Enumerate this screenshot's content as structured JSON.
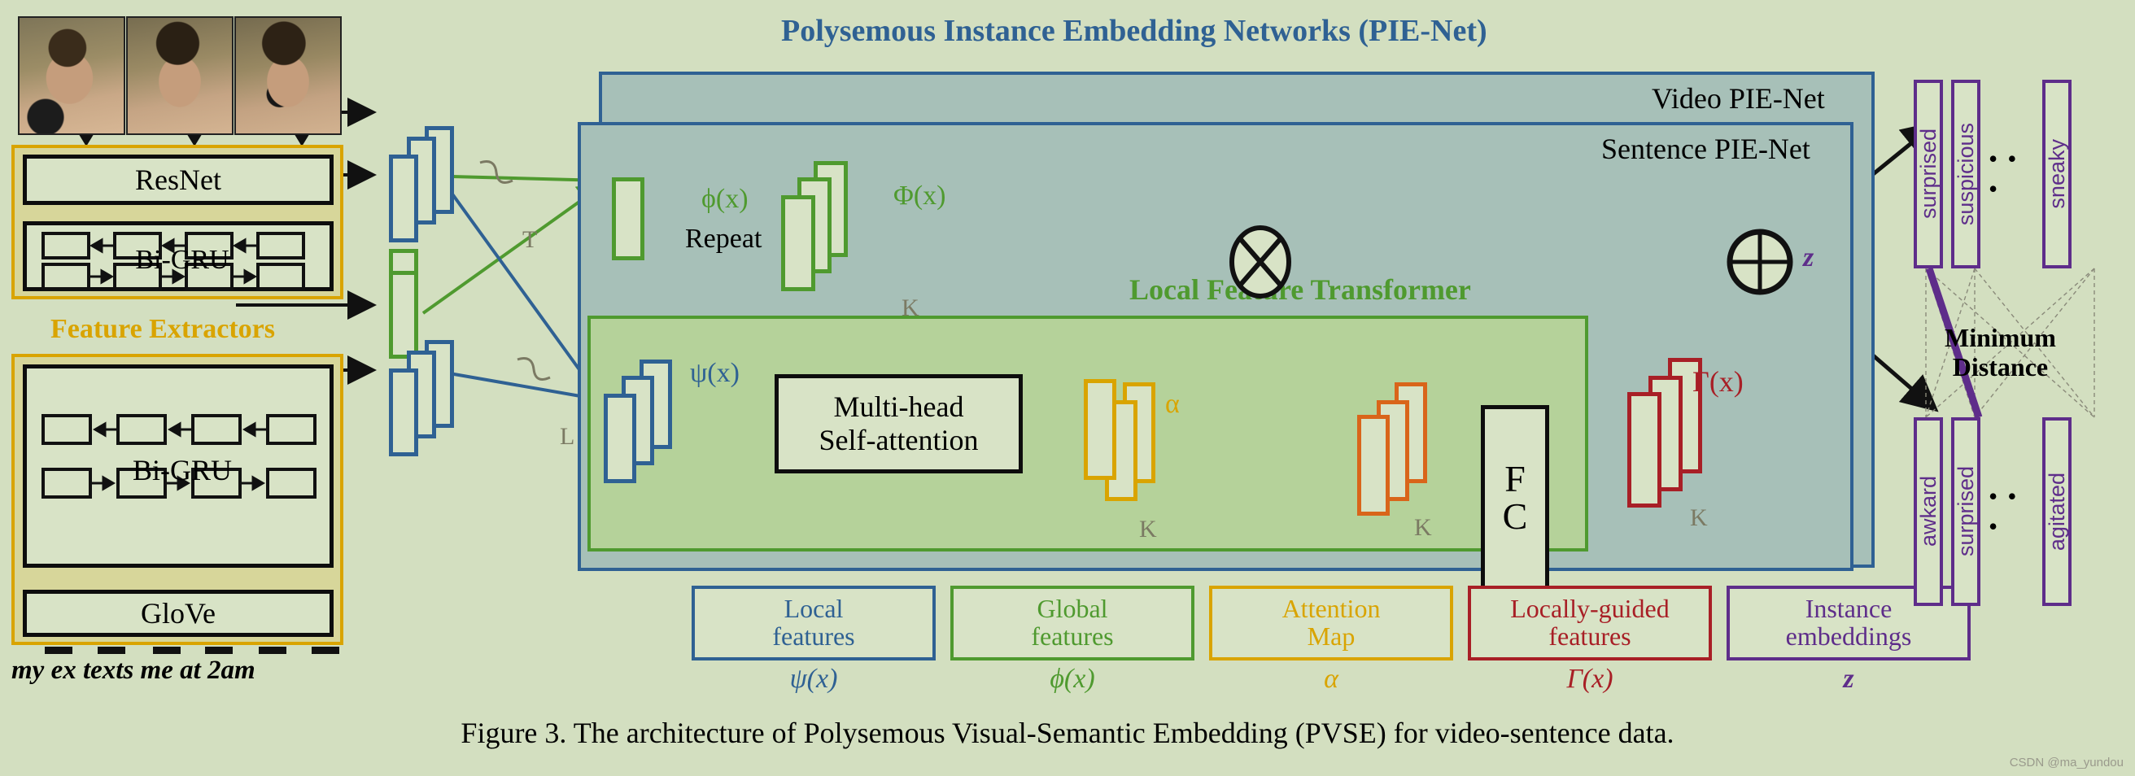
{
  "figure": {
    "caption": "Figure 3. The architecture of Polysemous Visual-Semantic Embedding (PVSE) for video-sentence data.",
    "watermark": "CSDN @ma_yundou"
  },
  "colors": {
    "background": "#d3dfc0",
    "local_blue": "#2f6193",
    "global_green": "#4f9a2f",
    "attention_yellow": "#d9a400",
    "locally_guided_red": "#a81f26",
    "instance_purple": "#5e2d8a",
    "orange": "#d9651a",
    "pie_panel": "#a7c0b8",
    "lft_panel": "#b5d29a",
    "extractor_panel": "#d7d69a"
  },
  "feature_extractors": {
    "group_label": "Feature Extractors",
    "video_blocks": [
      "ResNet",
      "Bi-GRU"
    ],
    "text_blocks": [
      "Bi-GRU",
      "GloVe"
    ],
    "sentence": "my ex texts me at 2am",
    "seq_labels": {
      "video": "T",
      "text": "L"
    }
  },
  "pie_net": {
    "title": "Polysemous Instance Embedding Networks (PIE-Net)",
    "video_label": "Video PIE-Net",
    "sentence_label": "Sentence PIE-Net",
    "global_path": {
      "phi_small": "ϕ(x)",
      "repeat": "Repeat",
      "phi_big": "Φ(x)",
      "k_label": "K"
    },
    "local_transformer": {
      "title": "Local Feature Transformer",
      "psi": "ψ(x)",
      "attention_block": [
        "Multi-head",
        "Self-attention"
      ],
      "alpha": "α",
      "fc": [
        "F",
        "C"
      ],
      "gamma": "Γ(x)",
      "z": "z",
      "k_labels": [
        "K",
        "K",
        "K",
        "K"
      ]
    }
  },
  "legend": [
    {
      "name": "local-features",
      "line1": "Local",
      "line2": "features",
      "symbol": "ψ(x)",
      "color": "#2f6193"
    },
    {
      "name": "global-features",
      "line1": "Global",
      "line2": "features",
      "symbol": "ϕ(x)",
      "color": "#4f9a2f"
    },
    {
      "name": "attention-map",
      "line1": "Attention",
      "line2": "Map",
      "symbol": "α",
      "color": "#d9a400"
    },
    {
      "name": "locally-guided",
      "line1": "Locally-guided",
      "line2": "features",
      "symbol": "Γ(x)",
      "color": "#a81f26"
    },
    {
      "name": "instance-embeddings",
      "line1": "Instance",
      "line2": "embeddings",
      "symbol": "z",
      "color": "#5e2d8a"
    }
  ],
  "embeddings": {
    "min_distance_label_line1": "Minimum",
    "min_distance_label_line2": "Distance",
    "ellipsis": "• • •",
    "top_row": [
      "surprised",
      "suspicious",
      "sneaky"
    ],
    "bottom_row": [
      "awkard",
      "surprised",
      "agitated"
    ]
  }
}
